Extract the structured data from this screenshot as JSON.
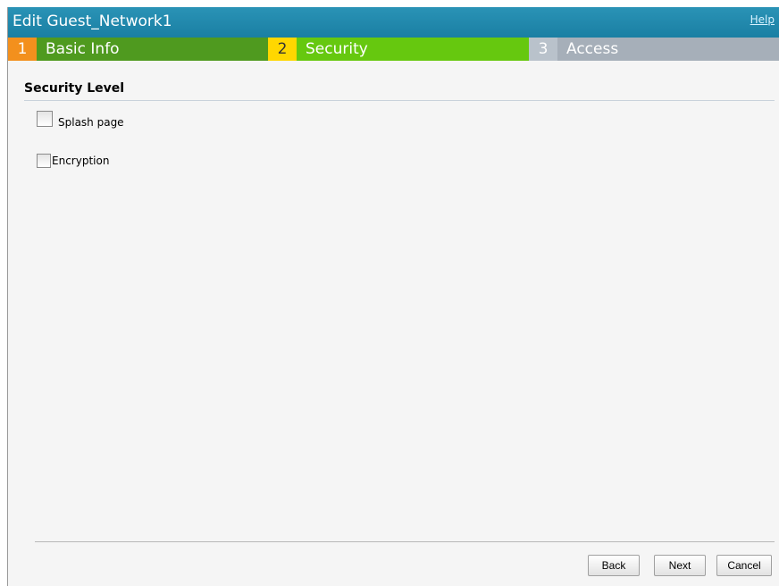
{
  "dialog": {
    "title": "Edit Guest_Network1",
    "help_label": "Help"
  },
  "steps": [
    {
      "number": "1",
      "label": "Basic Info"
    },
    {
      "number": "2",
      "label": "Security"
    },
    {
      "number": "3",
      "label": "Access"
    }
  ],
  "section": {
    "title": "Security Level"
  },
  "options": {
    "splash_page": {
      "label": "Splash page",
      "checked": false
    },
    "encryption": {
      "label": "Encryption",
      "checked": false
    }
  },
  "buttons": {
    "back": "Back",
    "next": "Next",
    "cancel": "Cancel"
  },
  "colors": {
    "titlebar": "#1a7fa3",
    "step1_number": "#f3901d",
    "step1_label": "#4f9a1f",
    "step2_number": "#ffd700",
    "step2_label": "#66c80f",
    "step3_number": "#b9c2cb",
    "step3_label": "#a6afb9"
  }
}
